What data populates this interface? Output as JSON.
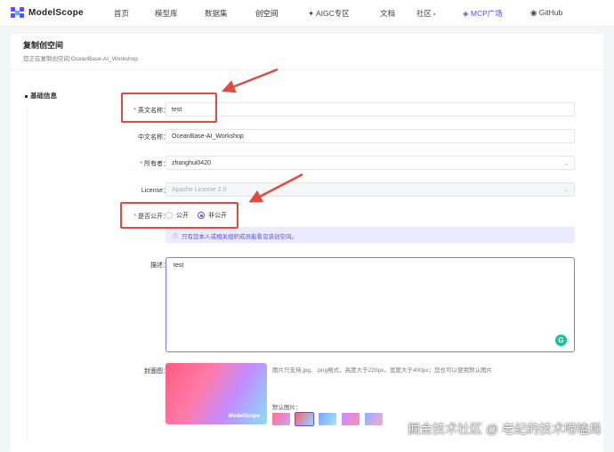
{
  "brand": {
    "name": "ModelScope"
  },
  "nav": {
    "items": [
      {
        "label": "首页"
      },
      {
        "label": "模型库"
      },
      {
        "label": "数据集"
      },
      {
        "label": "创空间"
      },
      {
        "label": "AIGC专区"
      },
      {
        "label": "文档"
      },
      {
        "label": "社区"
      },
      {
        "label": "MCP广场"
      },
      {
        "label": "GitHub"
      }
    ]
  },
  "page": {
    "title": "复制创空间",
    "subtitle": "您正在复制创空间:OceanBase-AI_Workshop"
  },
  "section": {
    "title": "基础信息"
  },
  "form": {
    "english_name": {
      "label": "英文名称",
      "value": "test"
    },
    "chinese_name": {
      "label": "中文名称",
      "value": "OceanBase-AI_Workshop"
    },
    "owner": {
      "label": "所有者",
      "value": "zhanghui0420"
    },
    "license": {
      "label": "License",
      "value": "Apache License 2.0"
    },
    "visibility": {
      "label": "是否公开",
      "options": [
        "公开",
        "非公开"
      ],
      "selected": "非公开"
    },
    "notice": "只有您本人或相关组织成员能看见该创空间。",
    "description": {
      "label": "描述",
      "value": "test"
    },
    "cover": {
      "label": "封面图",
      "brand": "ModelScope",
      "hint": "图片只支持.jpg、.png格式，高度大于220px，宽度大于400px；您也可以使用默认图片",
      "default_label": "默认图片："
    }
  },
  "colors": {
    "accent": "#624aff",
    "callout": "#e04a3f",
    "grammarly": "#15c39a"
  },
  "icons": {
    "grammarly": "grammarly-icon",
    "info": "info-icon",
    "github": "github-icon",
    "chevron": "chevron-down-icon"
  },
  "watermark": "掘金技术社区 @ 老纪的技术唠嗑局"
}
